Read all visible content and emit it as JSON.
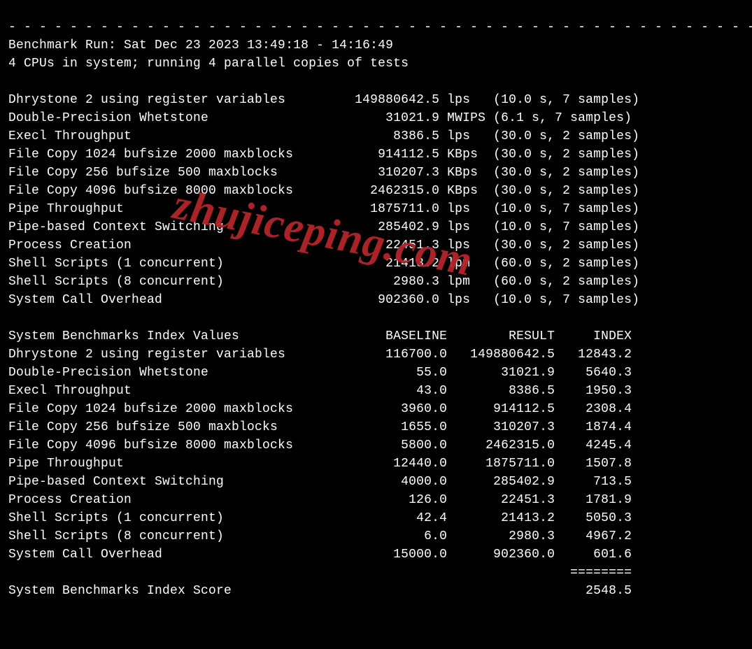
{
  "separator_line": "- - - - - - - - - - - - - - - - - - - - - - - - - - - - - - - - - - - - - - - - - - - - - - - - -",
  "header": {
    "run_line": "Benchmark Run: Sat Dec 23 2023 13:49:18 - 14:16:49",
    "cpu_line": "4 CPUs in system; running 4 parallel copies of tests"
  },
  "results": [
    {
      "name": "Dhrystone 2 using register variables",
      "value": "149880642.5",
      "unit": "lps",
      "timing": "(10.0 s, 7 samples)"
    },
    {
      "name": "Double-Precision Whetstone",
      "value": "31021.9",
      "unit": "MWIPS",
      "timing": "(6.1 s, 7 samples)"
    },
    {
      "name": "Execl Throughput",
      "value": "8386.5",
      "unit": "lps",
      "timing": "(30.0 s, 2 samples)"
    },
    {
      "name": "File Copy 1024 bufsize 2000 maxblocks",
      "value": "914112.5",
      "unit": "KBps",
      "timing": "(30.0 s, 2 samples)"
    },
    {
      "name": "File Copy 256 bufsize 500 maxblocks",
      "value": "310207.3",
      "unit": "KBps",
      "timing": "(30.0 s, 2 samples)"
    },
    {
      "name": "File Copy 4096 bufsize 8000 maxblocks",
      "value": "2462315.0",
      "unit": "KBps",
      "timing": "(30.0 s, 2 samples)"
    },
    {
      "name": "Pipe Throughput",
      "value": "1875711.0",
      "unit": "lps",
      "timing": "(10.0 s, 7 samples)"
    },
    {
      "name": "Pipe-based Context Switching",
      "value": "285402.9",
      "unit": "lps",
      "timing": "(10.0 s, 7 samples)"
    },
    {
      "name": "Process Creation",
      "value": "22451.3",
      "unit": "lps",
      "timing": "(30.0 s, 2 samples)"
    },
    {
      "name": "Shell Scripts (1 concurrent)",
      "value": "21413.2",
      "unit": "lpm",
      "timing": "(60.0 s, 2 samples)"
    },
    {
      "name": "Shell Scripts (8 concurrent)",
      "value": "2980.3",
      "unit": "lpm",
      "timing": "(60.0 s, 2 samples)"
    },
    {
      "name": "System Call Overhead",
      "value": "902360.0",
      "unit": "lps",
      "timing": "(10.0 s, 7 samples)"
    }
  ],
  "index_table": {
    "header": {
      "title": "System Benchmarks Index Values",
      "col_baseline": "BASELINE",
      "col_result": "RESULT",
      "col_index": "INDEX"
    },
    "rows": [
      {
        "name": "Dhrystone 2 using register variables",
        "baseline": "116700.0",
        "result": "149880642.5",
        "index": "12843.2"
      },
      {
        "name": "Double-Precision Whetstone",
        "baseline": "55.0",
        "result": "31021.9",
        "index": "5640.3"
      },
      {
        "name": "Execl Throughput",
        "baseline": "43.0",
        "result": "8386.5",
        "index": "1950.3"
      },
      {
        "name": "File Copy 1024 bufsize 2000 maxblocks",
        "baseline": "3960.0",
        "result": "914112.5",
        "index": "2308.4"
      },
      {
        "name": "File Copy 256 bufsize 500 maxblocks",
        "baseline": "1655.0",
        "result": "310207.3",
        "index": "1874.4"
      },
      {
        "name": "File Copy 4096 bufsize 8000 maxblocks",
        "baseline": "5800.0",
        "result": "2462315.0",
        "index": "4245.4"
      },
      {
        "name": "Pipe Throughput",
        "baseline": "12440.0",
        "result": "1875711.0",
        "index": "1507.8"
      },
      {
        "name": "Pipe-based Context Switching",
        "baseline": "4000.0",
        "result": "285402.9",
        "index": "713.5"
      },
      {
        "name": "Process Creation",
        "baseline": "126.0",
        "result": "22451.3",
        "index": "1781.9"
      },
      {
        "name": "Shell Scripts (1 concurrent)",
        "baseline": "42.4",
        "result": "21413.2",
        "index": "5050.3"
      },
      {
        "name": "Shell Scripts (8 concurrent)",
        "baseline": "6.0",
        "result": "2980.3",
        "index": "4967.2"
      },
      {
        "name": "System Call Overhead",
        "baseline": "15000.0",
        "result": "902360.0",
        "index": "601.6"
      }
    ],
    "divider": "========",
    "score_label": "System Benchmarks Index Score",
    "score_value": "2548.5"
  },
  "watermark": "zhujiceping.com"
}
